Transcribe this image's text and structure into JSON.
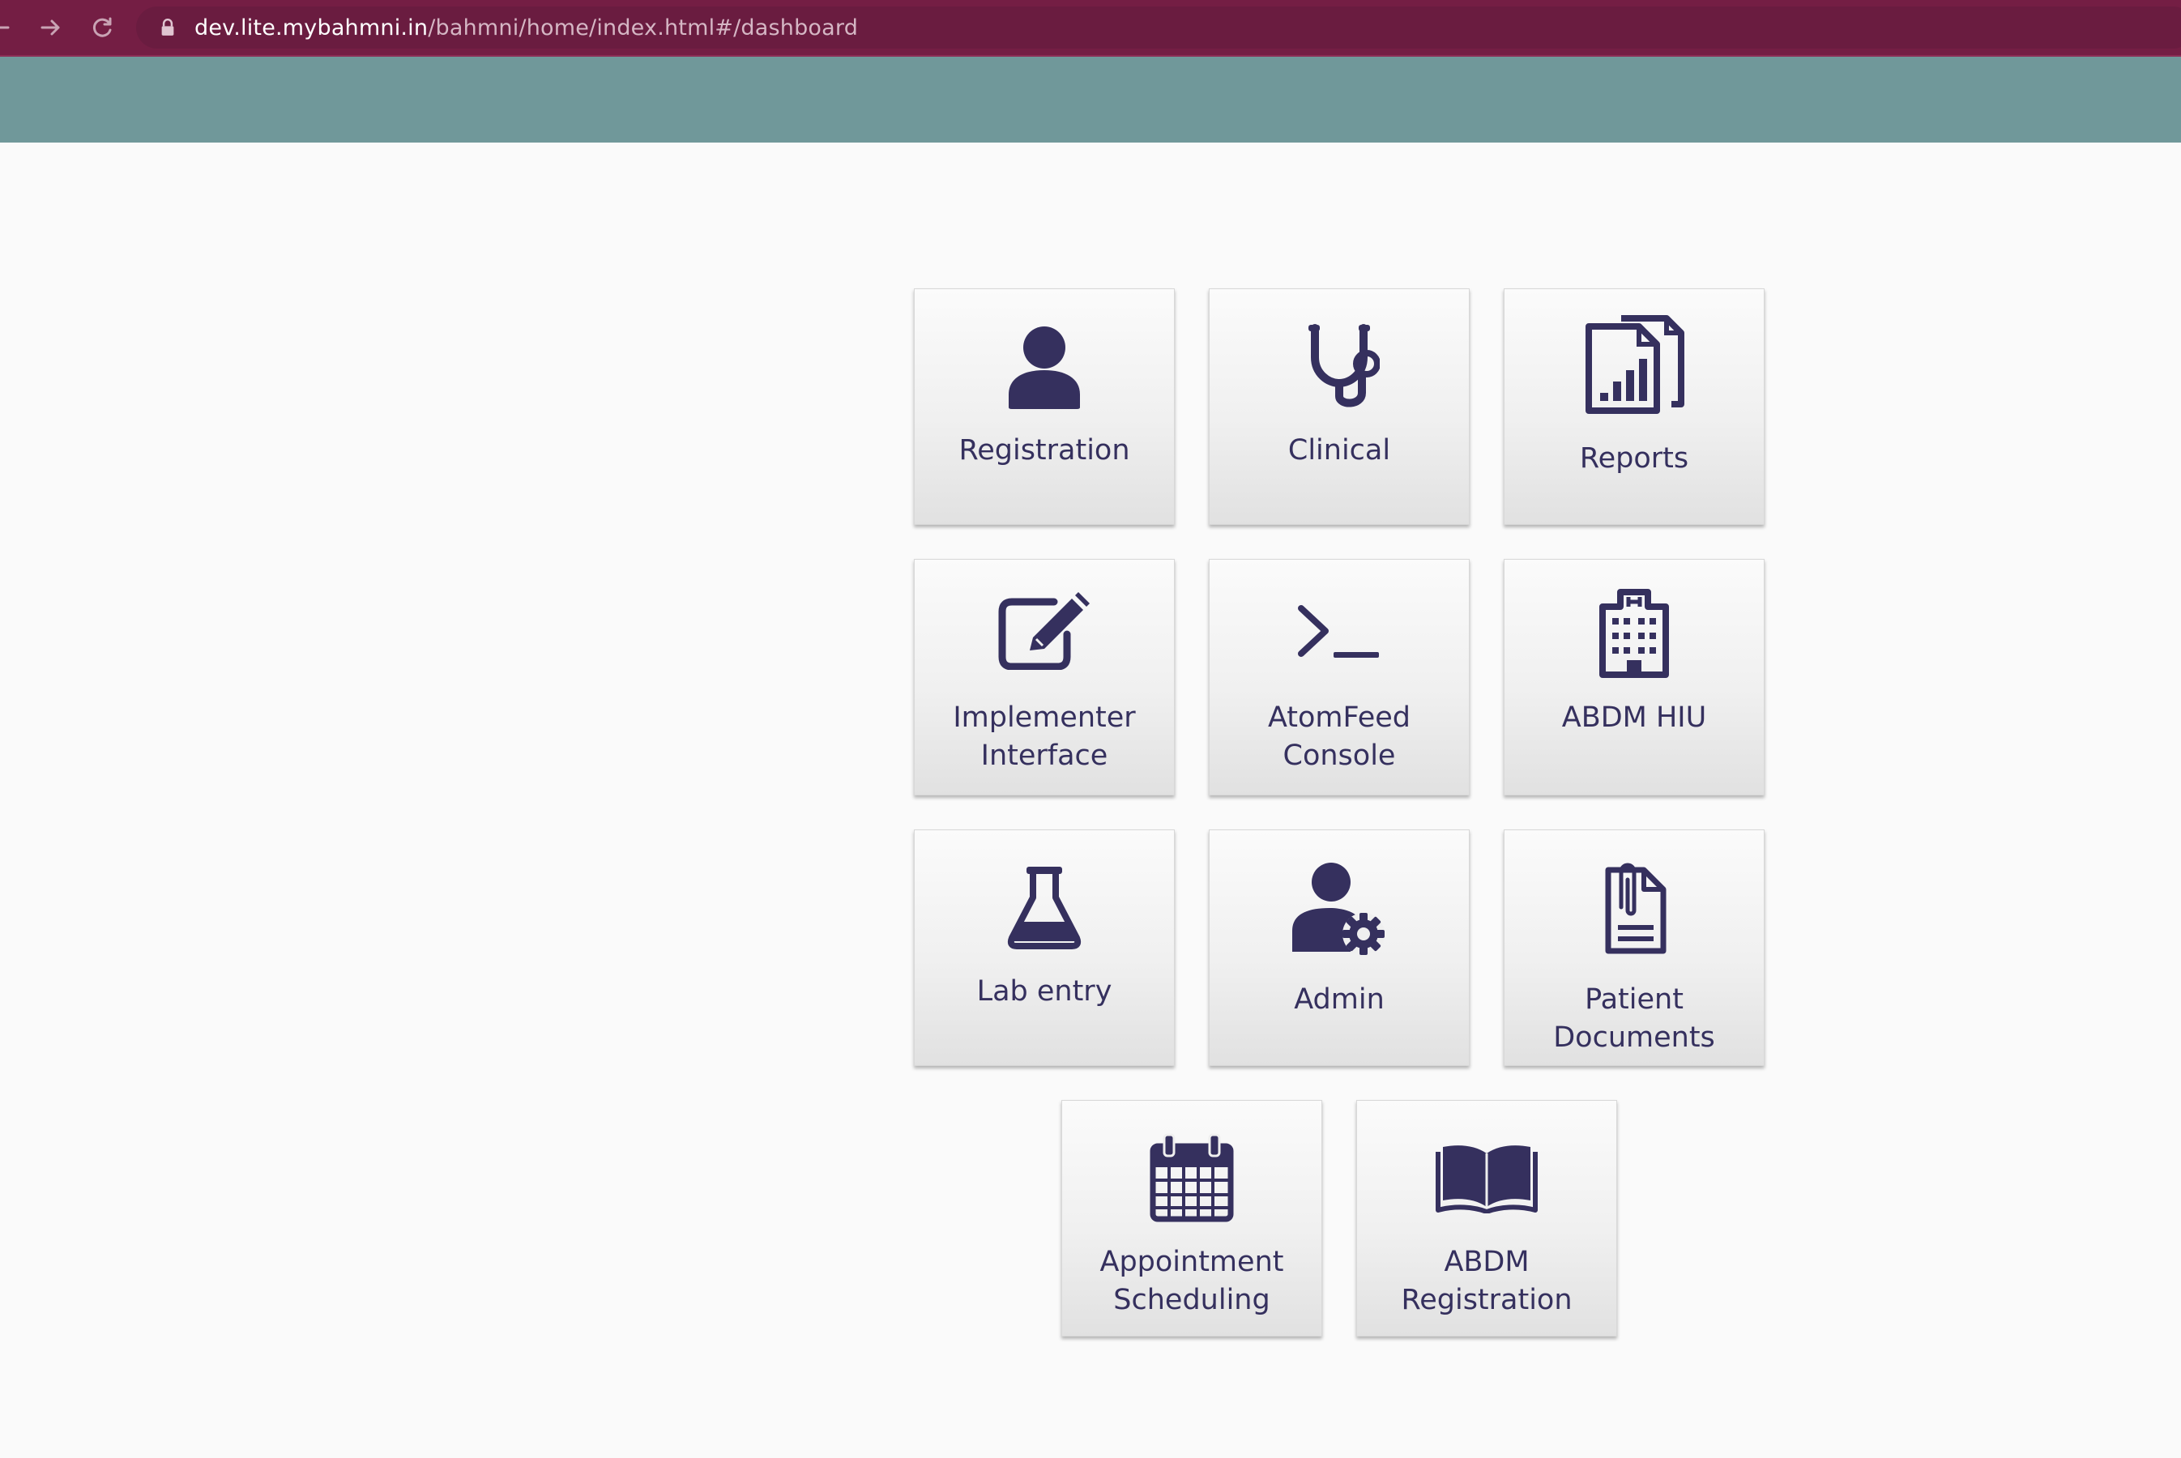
{
  "browser": {
    "url_host": "dev.lite.mybahmni.in",
    "url_path": "/bahmni/home/index.html#/dashboard",
    "nav": {
      "back_icon": "arrow-left-icon",
      "forward_icon": "arrow-right-icon",
      "reload_icon": "reload-icon",
      "lock_icon": "lock-icon"
    }
  },
  "header": {
    "color": "#70989a"
  },
  "theme": {
    "browser_bar": "#741e44",
    "icon_color": "#35305e",
    "text_color": "#35305e"
  },
  "dashboard": {
    "apps": [
      {
        "label": "Registration",
        "icon": "person-icon"
      },
      {
        "label": "Clinical",
        "icon": "stethoscope-icon"
      },
      {
        "label": "Reports",
        "icon": "report-chart-icon"
      },
      {
        "label_line1": "Implementer",
        "label_line2": "Interface",
        "icon": "edit-icon"
      },
      {
        "label_line1": "AtomFeed",
        "label_line2": "Console",
        "icon": "terminal-icon"
      },
      {
        "label": "ABDM HIU",
        "icon": "hospital-icon"
      },
      {
        "label": "Lab entry",
        "icon": "flask-icon"
      },
      {
        "label": "Admin",
        "icon": "user-gear-icon"
      },
      {
        "label_line1": "Patient",
        "label_line2": "Documents",
        "icon": "document-clip-icon"
      },
      {
        "label_line1": "Appointment",
        "label_line2": "Scheduling",
        "icon": "calendar-icon"
      },
      {
        "label_line1": "ABDM",
        "label_line2": "Registration",
        "icon": "open-book-icon"
      }
    ]
  }
}
